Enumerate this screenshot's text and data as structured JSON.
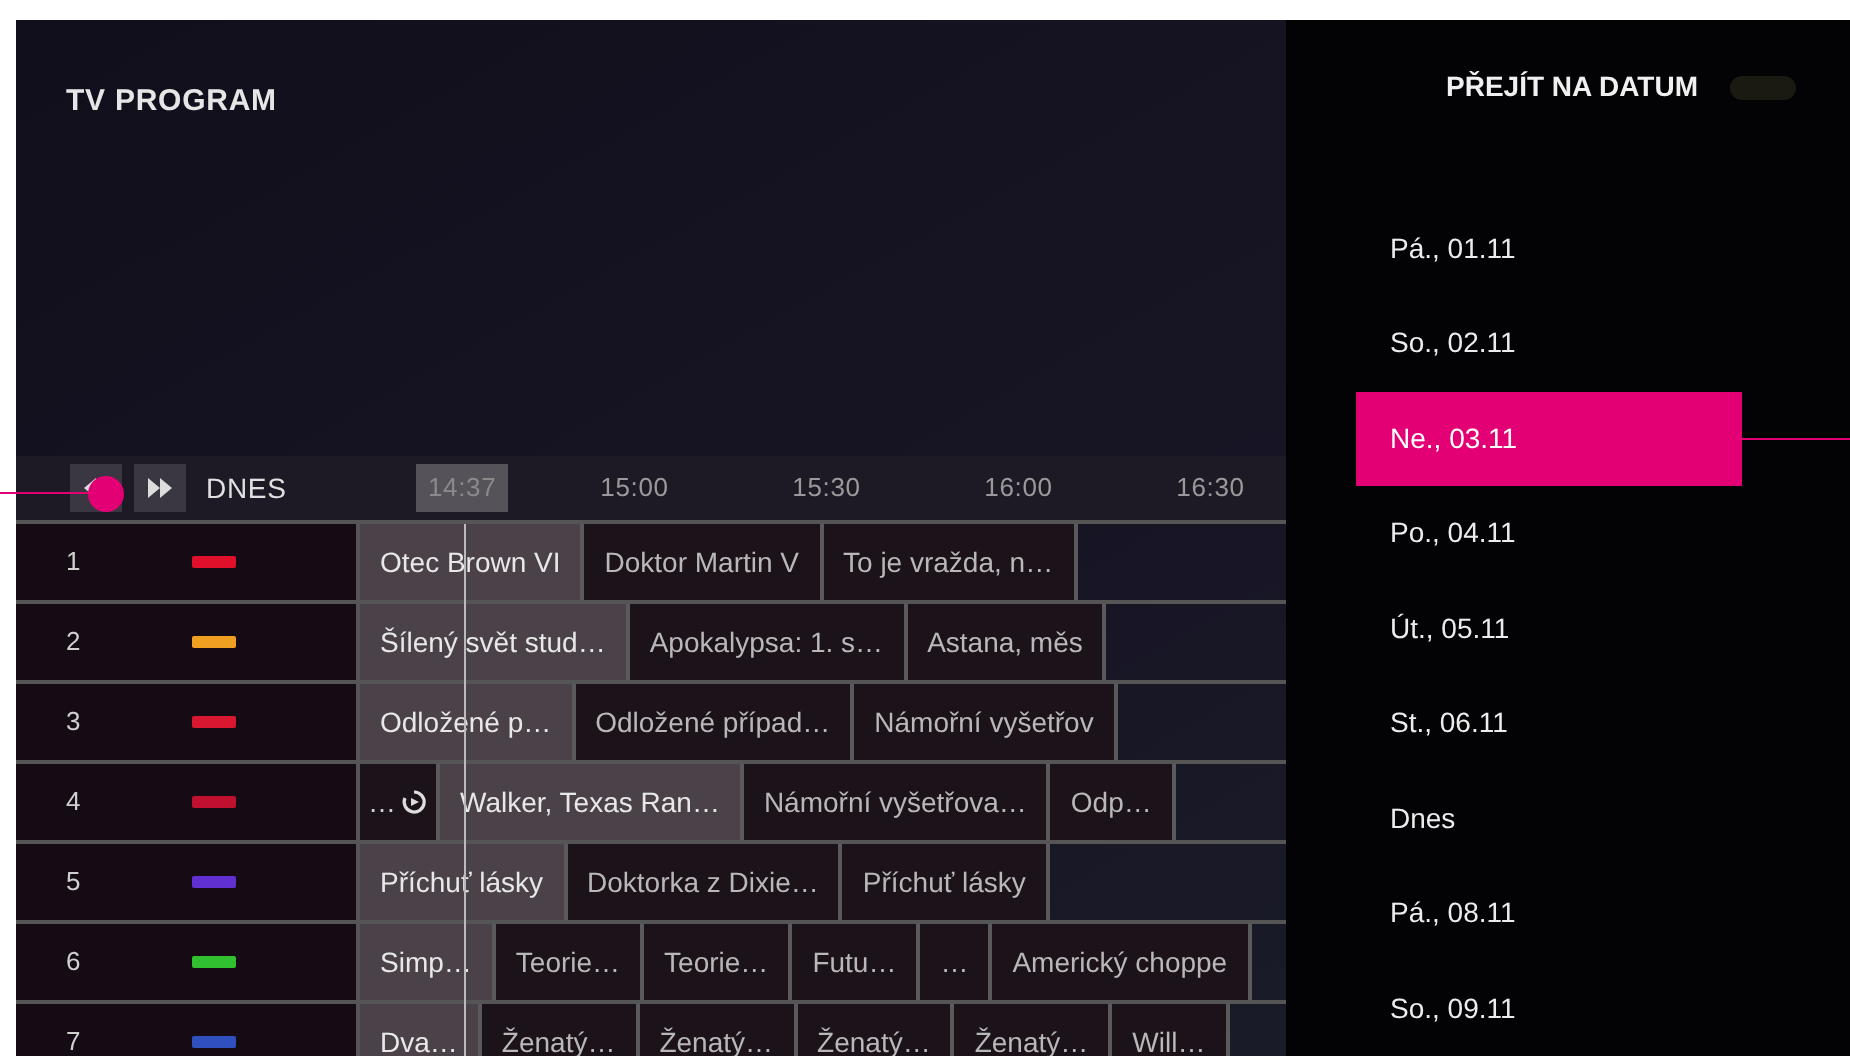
{
  "header": {
    "title": "TV PROGRAM"
  },
  "timeline": {
    "day": "DNES",
    "current_time": "14:37",
    "times": [
      "15:00",
      "15:30",
      "16:00",
      "16:30"
    ]
  },
  "channels": [
    {
      "number": "1",
      "color": "#e0102a",
      "programmes": [
        {
          "kind": "show",
          "title": "Otec Brown VI",
          "now": true
        },
        {
          "kind": "show",
          "title": "Doktor Martin V",
          "now": false
        },
        {
          "kind": "show",
          "title": "To je vražda, n…",
          "now": false
        }
      ]
    },
    {
      "number": "2",
      "color": "#f0a020",
      "programmes": [
        {
          "kind": "show",
          "title": "Šílený svět stud…",
          "now": true
        },
        {
          "kind": "show",
          "title": "Apokalypsa: 1. s…",
          "now": false
        },
        {
          "kind": "show",
          "title": "Astana, měs",
          "now": false
        }
      ]
    },
    {
      "number": "3",
      "color": "#d81830",
      "programmes": [
        {
          "kind": "show",
          "title": "Odložené p…",
          "now": true
        },
        {
          "kind": "show",
          "title": "Odložené případ…",
          "now": false
        },
        {
          "kind": "show",
          "title": "Námořní vyšetřov",
          "now": false
        }
      ]
    },
    {
      "number": "4",
      "color": "#c01030",
      "programmes": [
        {
          "kind": "replay",
          "title": "…",
          "now": false
        },
        {
          "kind": "show",
          "title": "Walker, Texas Ran…",
          "now": true
        },
        {
          "kind": "show",
          "title": "Námořní vyšetřova…",
          "now": false
        },
        {
          "kind": "show",
          "title": "Odp…",
          "now": false
        }
      ]
    },
    {
      "number": "5",
      "color": "#6030d0",
      "programmes": [
        {
          "kind": "show",
          "title": "Příchuť lásky",
          "now": true
        },
        {
          "kind": "show",
          "title": "Doktorka z Dixie…",
          "now": false
        },
        {
          "kind": "show",
          "title": "Příchuť lásky",
          "now": false
        }
      ]
    },
    {
      "number": "6",
      "color": "#30c030",
      "programmes": [
        {
          "kind": "show",
          "title": "Simp…",
          "now": true
        },
        {
          "kind": "show",
          "title": "Teorie…",
          "now": false
        },
        {
          "kind": "show",
          "title": "Teorie…",
          "now": false
        },
        {
          "kind": "show",
          "title": "Futu…",
          "now": false
        },
        {
          "kind": "show",
          "title": "…",
          "now": false
        },
        {
          "kind": "show",
          "title": "Americký choppe",
          "now": false
        }
      ]
    },
    {
      "number": "7",
      "color": "#3050c0",
      "programmes": [
        {
          "kind": "show",
          "title": "Dva…",
          "now": true
        },
        {
          "kind": "show",
          "title": "Ženatý…",
          "now": false
        },
        {
          "kind": "show",
          "title": "Ženatý…",
          "now": false
        },
        {
          "kind": "show",
          "title": "Ženatý…",
          "now": false
        },
        {
          "kind": "show",
          "title": "Ženatý…",
          "now": false
        },
        {
          "kind": "show",
          "title": "Will…",
          "now": false
        }
      ]
    }
  ],
  "date_panel": {
    "title": "PŘEJÍT NA DATUM",
    "dates": [
      {
        "label": "Pá., 01.11",
        "selected": false
      },
      {
        "label": "So., 02.11",
        "selected": false
      },
      {
        "label": "Ne., 03.11",
        "selected": true
      },
      {
        "label": "Po., 04.11",
        "selected": false
      },
      {
        "label": "Út., 05.11",
        "selected": false
      },
      {
        "label": "St., 06.11",
        "selected": false
      },
      {
        "label": "Dnes",
        "selected": false
      },
      {
        "label": "Pá., 08.11",
        "selected": false
      },
      {
        "label": "So., 09.11",
        "selected": false
      }
    ]
  }
}
